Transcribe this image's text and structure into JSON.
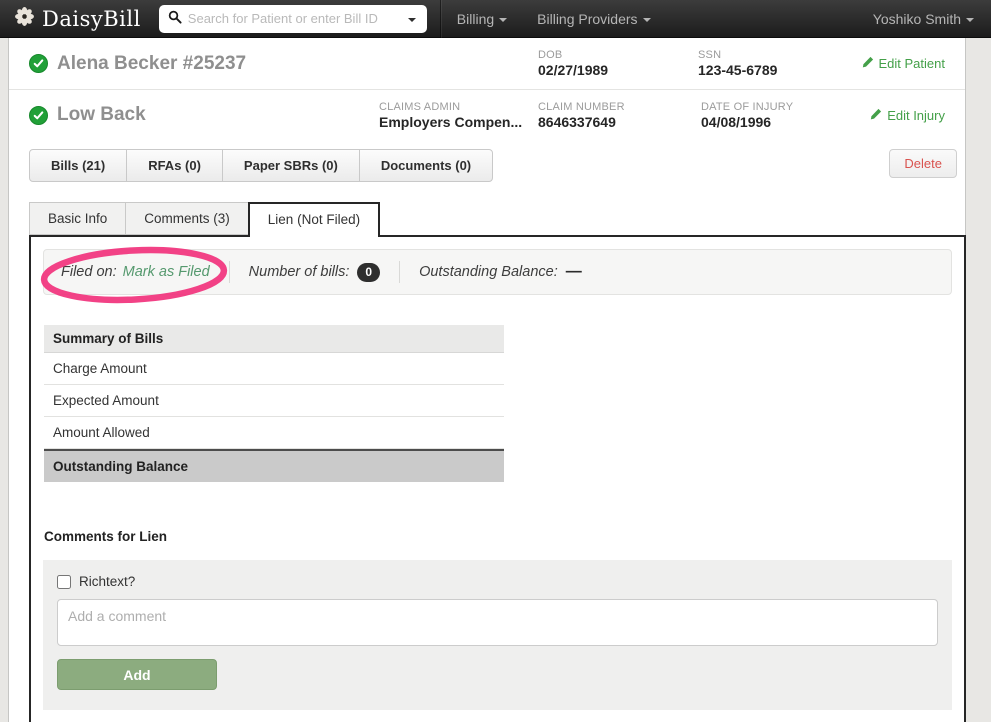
{
  "navbar": {
    "brand": "DaisyBill",
    "search": {
      "placeholder": "Search for Patient or enter Bill ID"
    },
    "menus": [
      {
        "label": "Billing"
      },
      {
        "label": "Billing Providers"
      }
    ],
    "user": "Yoshiko Smith"
  },
  "patient": {
    "name": "Alena Becker #25237",
    "fields": [
      {
        "label": "DOB",
        "value": "02/27/1989"
      },
      {
        "label": "SSN",
        "value": "123-45-6789"
      }
    ],
    "edit_label": "Edit Patient"
  },
  "injury": {
    "name": "Low Back",
    "fields": [
      {
        "label": "CLAIMS ADMIN",
        "value": "Employers Compen..."
      },
      {
        "label": "CLAIM NUMBER",
        "value": "8646337649"
      },
      {
        "label": "DATE OF INJURY",
        "value": "04/08/1996"
      }
    ],
    "edit_label": "Edit Injury"
  },
  "actions": {
    "delete_label": "Delete"
  },
  "resource_tabs": [
    {
      "label": "Bills (21)"
    },
    {
      "label": "RFAs (0)"
    },
    {
      "label": "Paper SBRs (0)"
    },
    {
      "label": "Documents (0)"
    }
  ],
  "detail_tabs": [
    {
      "label": "Basic Info",
      "active": false
    },
    {
      "label": "Comments (3)",
      "active": false
    },
    {
      "label": "Lien (Not Filed)",
      "active": true
    }
  ],
  "lien": {
    "status_bar": {
      "filed_on_label": "Filed on:",
      "filed_on_link": "Mark as Filed",
      "bills_label": "Number of bills:",
      "bills_count": "0",
      "balance_label": "Outstanding Balance:",
      "balance_value": "—"
    },
    "summary_table": {
      "header": "Summary of Bills",
      "rows": [
        "Charge Amount",
        "Expected Amount",
        "Amount Allowed"
      ],
      "footer": "Outstanding Balance"
    },
    "comments": {
      "title": "Comments for Lien",
      "richtext_label": "Richtext?",
      "placeholder": "Add a comment",
      "add_label": "Add"
    }
  },
  "icons": {
    "logo": "daisy-flower-icon",
    "search": "magnifier-icon",
    "status": "green-check-circle-icon",
    "edit": "pencil-icon",
    "dropdown": "caret-down-icon",
    "annotation": "pink-circle-annotation"
  },
  "colors": {
    "accent_green": "#44a049",
    "check_green": "#21a038",
    "link_green": "#55996e",
    "delete_red": "#d9534f",
    "add_button_green": "#8cac7f",
    "annotation_pink": "#f1327c",
    "badge_dark": "#2e2e2e",
    "navbar_dark": "#2a2a2a"
  }
}
